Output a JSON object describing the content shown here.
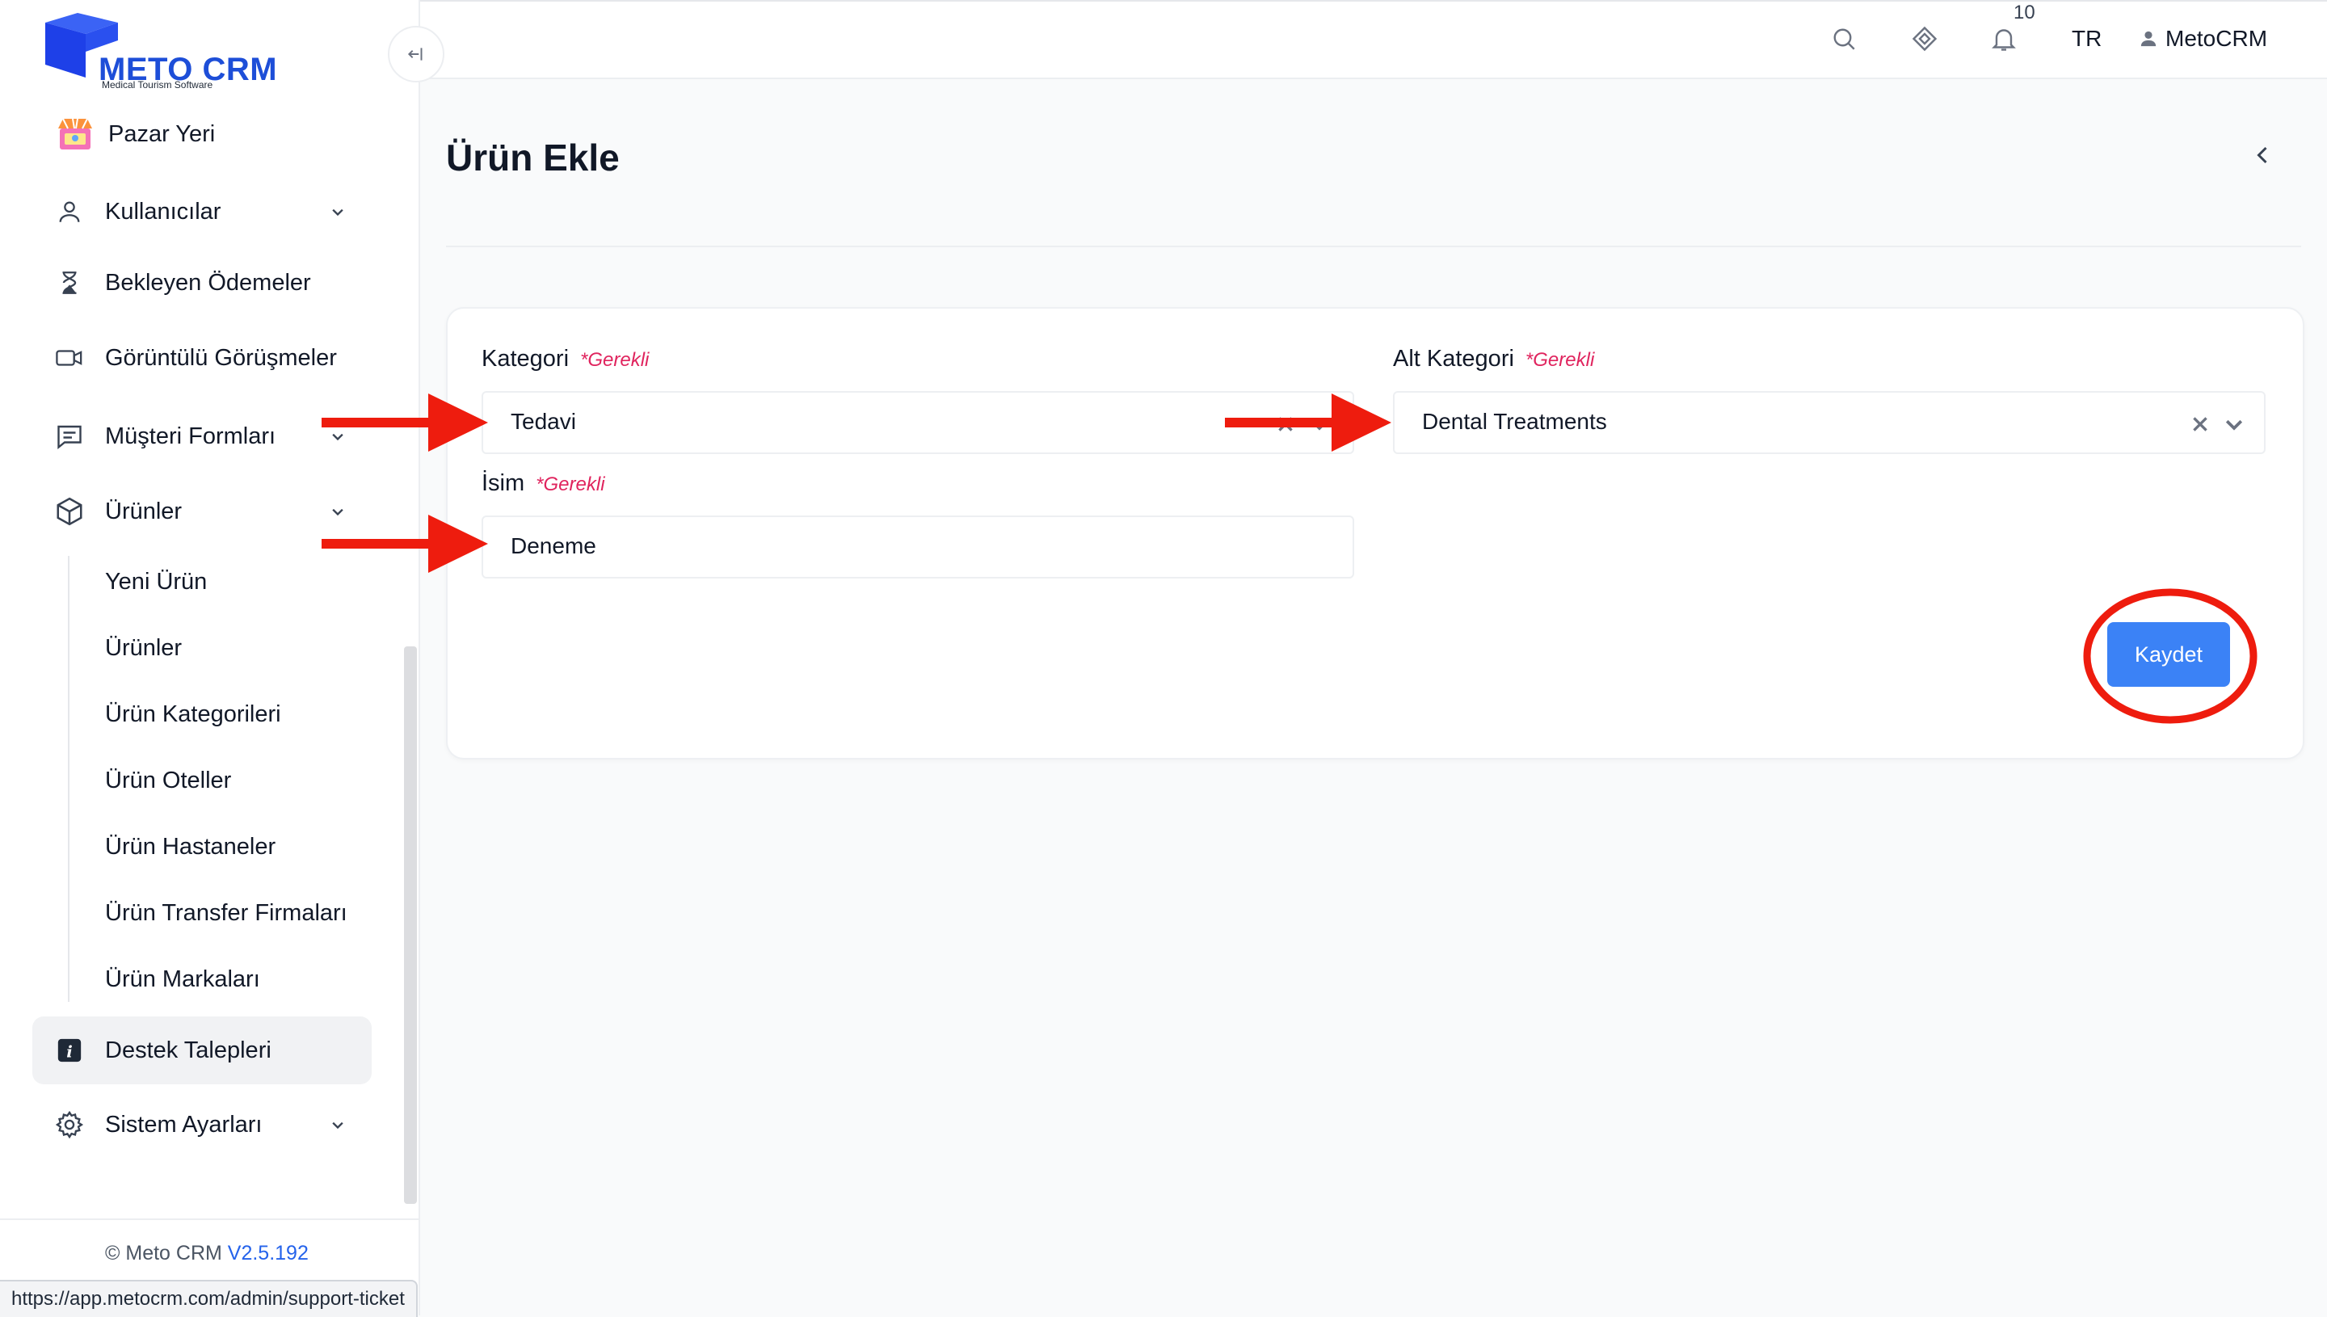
{
  "app": {
    "logo_text": "METO CRM",
    "logo_subtitle": "Medical Tourism Software"
  },
  "topbar": {
    "notification_count": "10",
    "language": "TR",
    "user_name": "MetoCRM"
  },
  "sidebar": {
    "items": [
      {
        "label": "Pazar Yeri",
        "icon": "marketplace-icon"
      },
      {
        "label": "Kullanıcılar",
        "icon": "user-icon",
        "expandable": true
      },
      {
        "label": "Bekleyen Ödemeler",
        "icon": "hourglass-icon"
      },
      {
        "label": "Görüntülü Görüşmeler",
        "icon": "video-camera-icon"
      },
      {
        "label": "Müşteri Formları",
        "icon": "form-icon",
        "expandable": true
      },
      {
        "label": "Ürünler",
        "icon": "box-icon",
        "expandable": true,
        "expanded": true
      },
      {
        "label": "Destek Talepleri",
        "icon": "info-icon",
        "active": true
      },
      {
        "label": "Sistem Ayarları",
        "icon": "gear-icon",
        "expandable": true
      }
    ],
    "products_submenu": [
      "Yeni Ürün",
      "Ürünler",
      "Ürün Kategorileri",
      "Ürün Oteller",
      "Ürün Hastaneler",
      "Ürün Transfer Firmaları",
      "Ürün Markaları"
    ],
    "footer_copyright": "© Meto CRM",
    "footer_version": "V2.5.192"
  },
  "page": {
    "title": "Ürün Ekle"
  },
  "form": {
    "required_label": "*Gerekli",
    "category": {
      "label": "Kategori",
      "value": "Tedavi"
    },
    "subcategory": {
      "label": "Alt Kategori",
      "value": "Dental Treatments"
    },
    "name": {
      "label": "İsim",
      "value": "Deneme"
    },
    "save_label": "Kaydet"
  },
  "status_bar": {
    "url": "https://app.metocrm.com/admin/support-ticket"
  },
  "colors": {
    "primary": "#3b82f6",
    "brand": "#1d4ed8",
    "required": "#e0245e",
    "annotation": "#ee1c0e"
  }
}
